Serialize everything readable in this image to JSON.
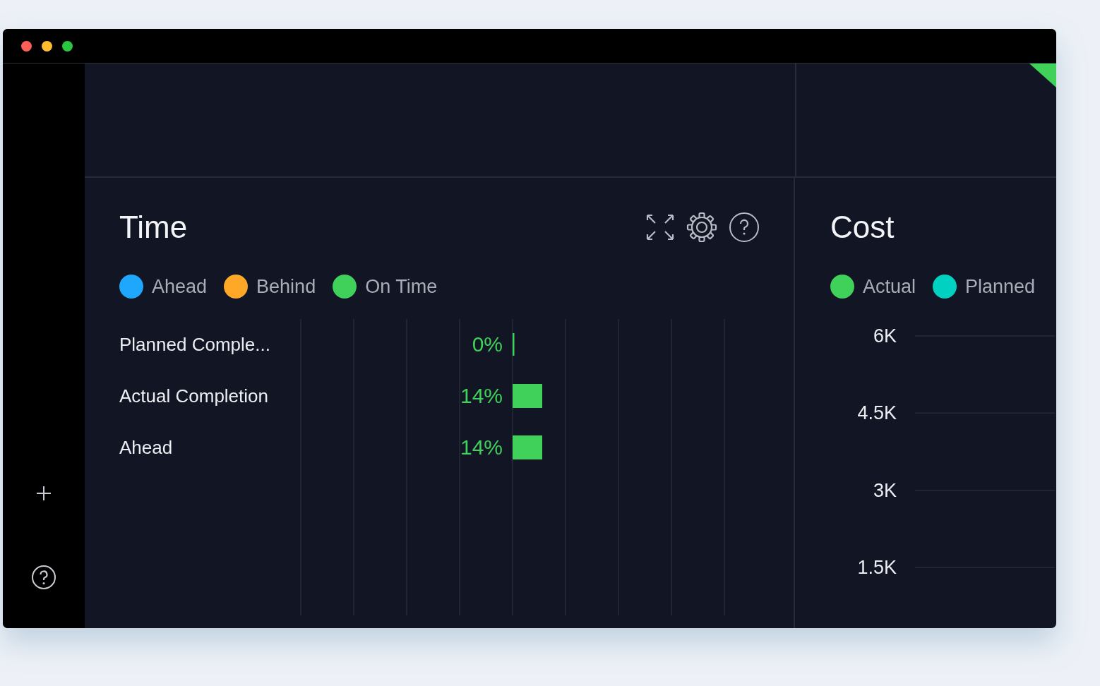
{
  "window": {
    "controls": [
      {
        "color": "#ff5f57"
      },
      {
        "color": "#febc2e"
      },
      {
        "color": "#28c840"
      }
    ]
  },
  "sidebar": {
    "buttons": [
      {
        "kind": "add"
      },
      {
        "kind": "help"
      }
    ]
  },
  "time_panel": {
    "title": "Time",
    "legend": [
      {
        "label": "Ahead",
        "color": "#1ea7fd"
      },
      {
        "label": "Behind",
        "color": "#ffa726"
      },
      {
        "label": "On Time",
        "color": "#3fd15a"
      }
    ],
    "chart_data": {
      "type": "bar",
      "orientation": "horizontal",
      "categories": [
        "Planned Comple...",
        "Actual Completion",
        "Ahead"
      ],
      "values": [
        0,
        14,
        14
      ],
      "value_labels": [
        "0%",
        "14%",
        "14%"
      ]
    }
  },
  "cost_panel": {
    "title": "Cost",
    "chart_data": {
      "type": "bar",
      "ylim": [
        0,
        6000
      ],
      "grid": true,
      "series": [
        {
          "name": "Actual",
          "color": "#3fd15a"
        },
        {
          "name": "Planned",
          "color": "#00d1c1"
        }
      ],
      "yticks": [
        {
          "value": 6000,
          "label": "6K"
        },
        {
          "value": 4500,
          "label": "4.5K"
        },
        {
          "value": 3000,
          "label": "3K"
        },
        {
          "value": 1500,
          "label": "1.5K"
        }
      ]
    }
  }
}
